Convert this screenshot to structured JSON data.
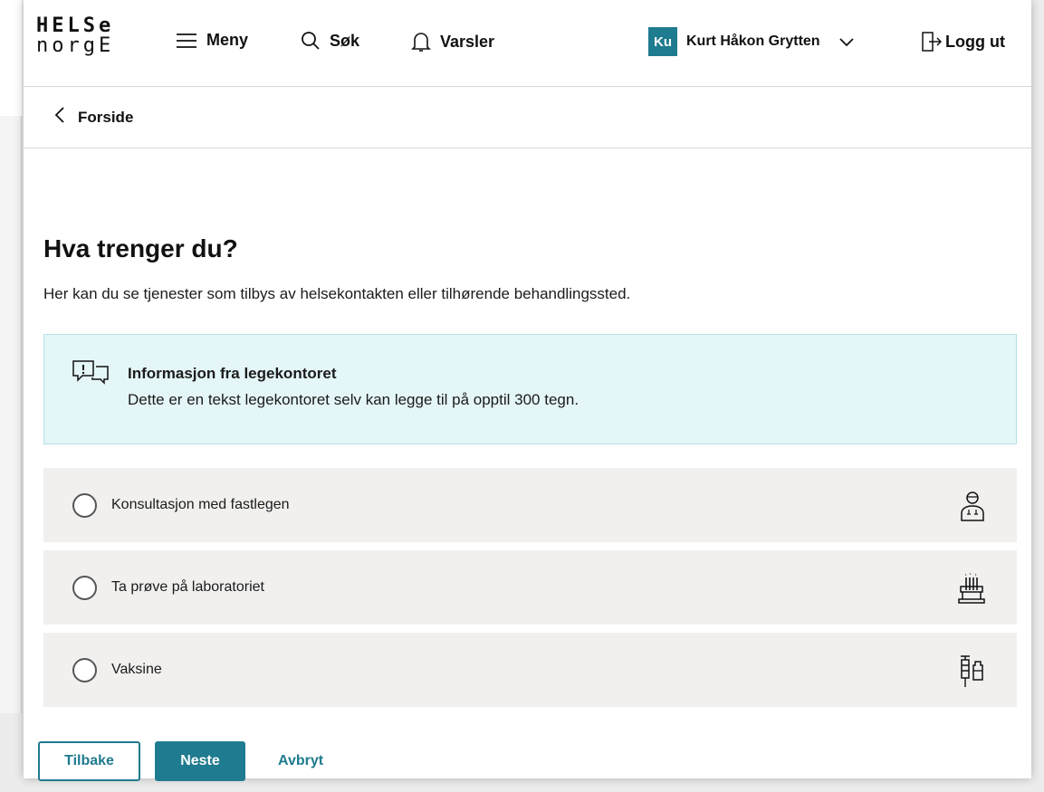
{
  "logo": {
    "line1": "HELSe",
    "line2": "norgE"
  },
  "header": {
    "menu_label": "Meny",
    "search_label": "Søk",
    "alerts_label": "Varsler",
    "user_initials": "Ku",
    "user_name": "Kurt Håkon Grytten",
    "logout_label": "Logg ut"
  },
  "breadcrumb": {
    "back_label": "Forside"
  },
  "main": {
    "title": "Hva trenger du?",
    "intro": "Her kan du se tjenester som tilbys av helsekontakten eller tilhørende behandlingssted."
  },
  "info": {
    "title": "Informasjon fra legekontoret",
    "text": "Dette er en tekst legekontoret selv kan legge til på opptil 300 tegn."
  },
  "options": [
    {
      "label": "Konsultasjon med fastlegen",
      "icon": "doctor-icon"
    },
    {
      "label": "Ta prøve på laboratoriet",
      "icon": "lab-icon"
    },
    {
      "label": "Vaksine",
      "icon": "vaccine-icon"
    }
  ],
  "buttons": {
    "back": "Tilbake",
    "next": "Neste",
    "cancel": "Avbryt"
  },
  "colors": {
    "accent": "#1f7b8f",
    "info_bg": "#e4f6f8",
    "option_bg": "#f1f0ef"
  }
}
